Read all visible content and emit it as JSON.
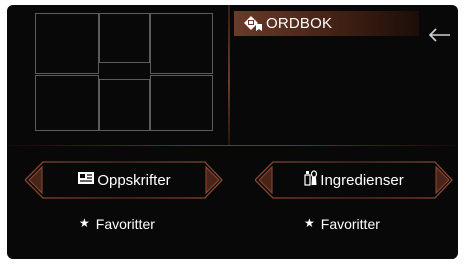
{
  "dictionary_tab": {
    "label": "ORDBOK",
    "icon": "book-tag-icon"
  },
  "back_button": {
    "icon": "arrow-left-icon"
  },
  "recipes_button": {
    "label": "Oppskrifter",
    "icon": "recipe-card-icon"
  },
  "ingredients_button": {
    "label": "Ingredienser",
    "icon": "spice-bottles-icon"
  },
  "favorites_left": {
    "label": "Favoritter",
    "icon": "star-icon"
  },
  "favorites_right": {
    "label": "Favoritter",
    "icon": "star-icon"
  },
  "colors": {
    "background": "#080808",
    "accent_copper": "#8b4a33",
    "tile_border": "#5c5c5c",
    "text": "#ffffff"
  }
}
